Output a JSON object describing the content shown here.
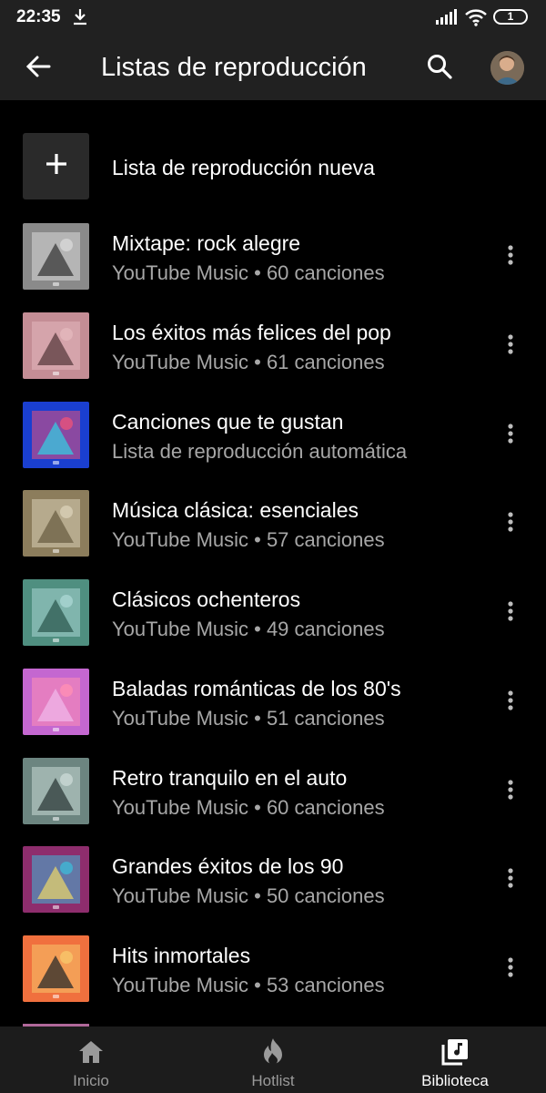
{
  "status_bar": {
    "time": "22:35",
    "battery": "1",
    "icons": [
      "download-icon",
      "signal-icon",
      "wifi-icon",
      "battery-icon"
    ]
  },
  "app_bar": {
    "title": "Listas de reproducción",
    "icons": [
      "back-arrow-icon",
      "search-icon",
      "avatar"
    ]
  },
  "new_playlist": {
    "label": "Lista de reproducción nueva",
    "icon": "plus-icon"
  },
  "playlists": [
    {
      "title": "Mixtape: rock alegre",
      "subtitle": "YouTube Music • 60 canciones",
      "colors": [
        "#8a8a8a",
        "#d8d8d8",
        "#3a3a3a"
      ]
    },
    {
      "title": "Los éxitos más felices del pop",
      "subtitle": "YouTube Music • 61 canciones",
      "colors": [
        "#c48d95",
        "#e4b8bd",
        "#5a3c3f"
      ]
    },
    {
      "title": "Canciones que te gustan",
      "subtitle": "Lista de reproducción automática",
      "colors": [
        "#1a3fd0",
        "#e8527a",
        "#35c9e0"
      ]
    },
    {
      "title": "Música clásica: esenciales",
      "subtitle": "YouTube Music • 57 canciones",
      "colors": [
        "#8c7d5c",
        "#d9cfb6",
        "#6b5f44"
      ]
    },
    {
      "title": "Clásicos ochenteros",
      "subtitle": "YouTube Music • 49 canciones",
      "colors": [
        "#4f8f80",
        "#a9d6d2",
        "#2e5b52"
      ]
    },
    {
      "title": "Baladas románticas de los 80's",
      "subtitle": "YouTube Music • 51 canciones",
      "colors": [
        "#c467d0",
        "#ff8fb4",
        "#f0b7e8"
      ]
    },
    {
      "title": "Retro tranquilo en el auto",
      "subtitle": "YouTube Music • 60 canciones",
      "colors": [
        "#6c8580",
        "#c9d8d4",
        "#2e3b39"
      ]
    },
    {
      "title": "Grandes éxitos de los 90",
      "subtitle": "YouTube Music • 50 canciones",
      "colors": [
        "#8e2d6d",
        "#3fb6d6",
        "#e4d26b"
      ]
    },
    {
      "title": "Hits inmortales",
      "subtitle": "YouTube Music • 53 canciones",
      "colors": [
        "#f0703e",
        "#f7c56a",
        "#2b2b2b"
      ]
    }
  ],
  "bottom_nav": [
    {
      "label": "Inicio",
      "icon": "home-icon",
      "active": false
    },
    {
      "label": "Hotlist",
      "icon": "flame-icon",
      "active": false
    },
    {
      "label": "Biblioteca",
      "icon": "library-icon",
      "active": true
    }
  ]
}
